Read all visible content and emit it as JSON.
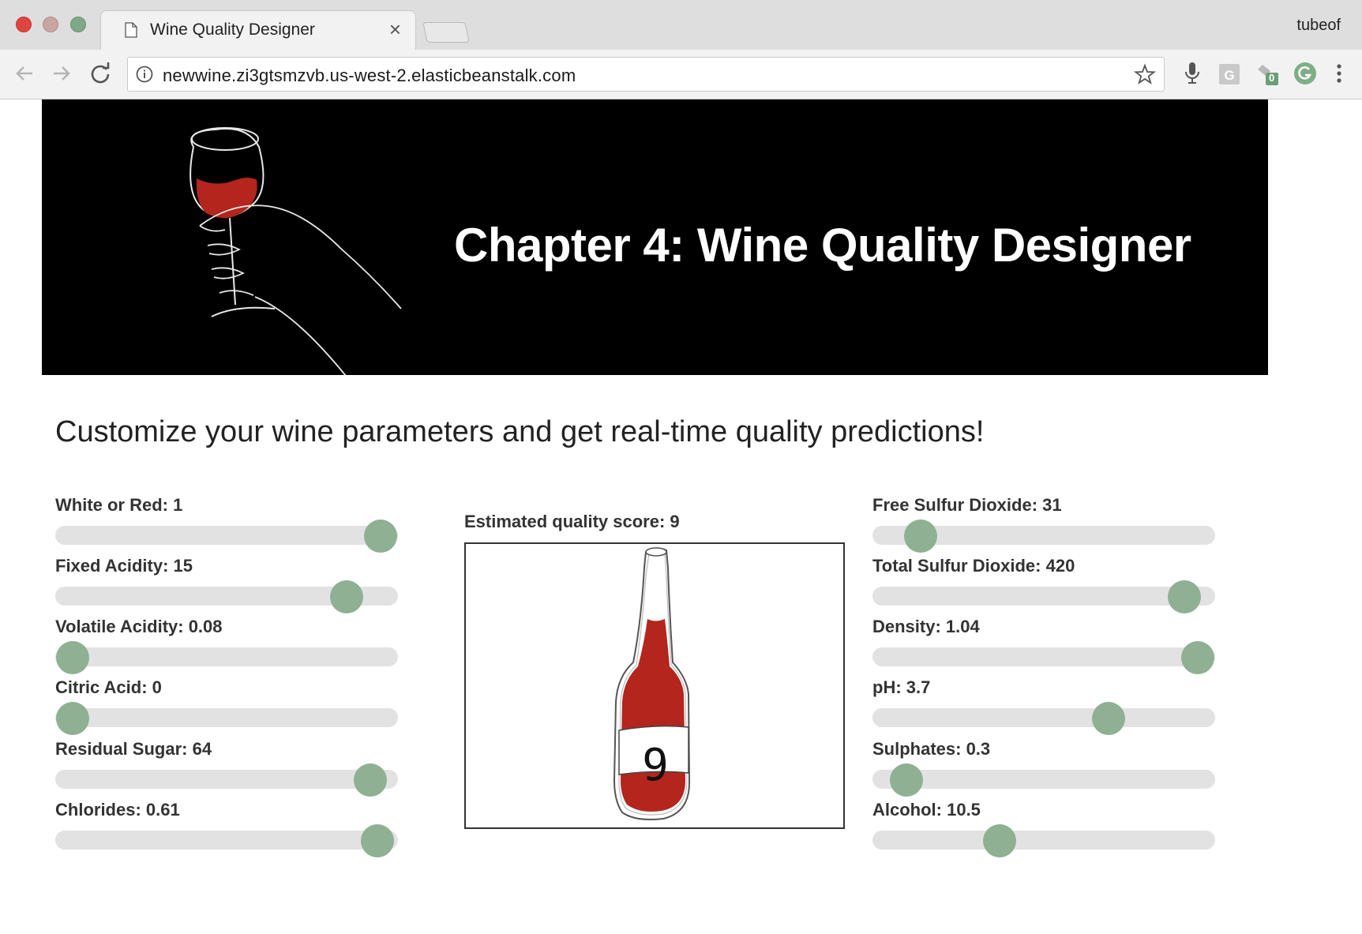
{
  "browser": {
    "tab_title": "Wine Quality Designer",
    "tab_close": "×",
    "profile_name": "tubeof",
    "url": "newwine.zi3gtsmzvb.us-west-2.elasticbeanstalk.com",
    "extension_badge": "0"
  },
  "banner": {
    "title": "Chapter 4: Wine Quality Designer"
  },
  "page": {
    "subtitle": "Customize your wine parameters and get real-time quality predictions!"
  },
  "sliders_left": [
    {
      "label": "White or Red: 1",
      "fraction": 0.95
    },
    {
      "label": "Fixed Acidity: 15",
      "fraction": 0.85
    },
    {
      "label": "Volatile Acidity: 0.08",
      "fraction": 0.05
    },
    {
      "label": "Citric Acid: 0",
      "fraction": 0.05
    },
    {
      "label": "Residual Sugar: 64",
      "fraction": 0.92
    },
    {
      "label": "Chlorides: 0.61",
      "fraction": 0.94
    }
  ],
  "sliders_right": [
    {
      "label": "Free Sulfur Dioxide: 31",
      "fraction": 0.14
    },
    {
      "label": "Total Sulfur Dioxide: 420",
      "fraction": 0.91
    },
    {
      "label": "Density: 1.04",
      "fraction": 0.95
    },
    {
      "label": "pH: 3.7",
      "fraction": 0.69
    },
    {
      "label": "Sulphates: 0.3",
      "fraction": 0.1
    },
    {
      "label": "Alcohol: 10.5",
      "fraction": 0.37
    }
  ],
  "prediction": {
    "label": "Estimated quality score: 9",
    "bottle_number": "9"
  },
  "colors": {
    "wine": "#b3251d",
    "thumb": "#8fb093",
    "track": "#e2e2e2"
  }
}
